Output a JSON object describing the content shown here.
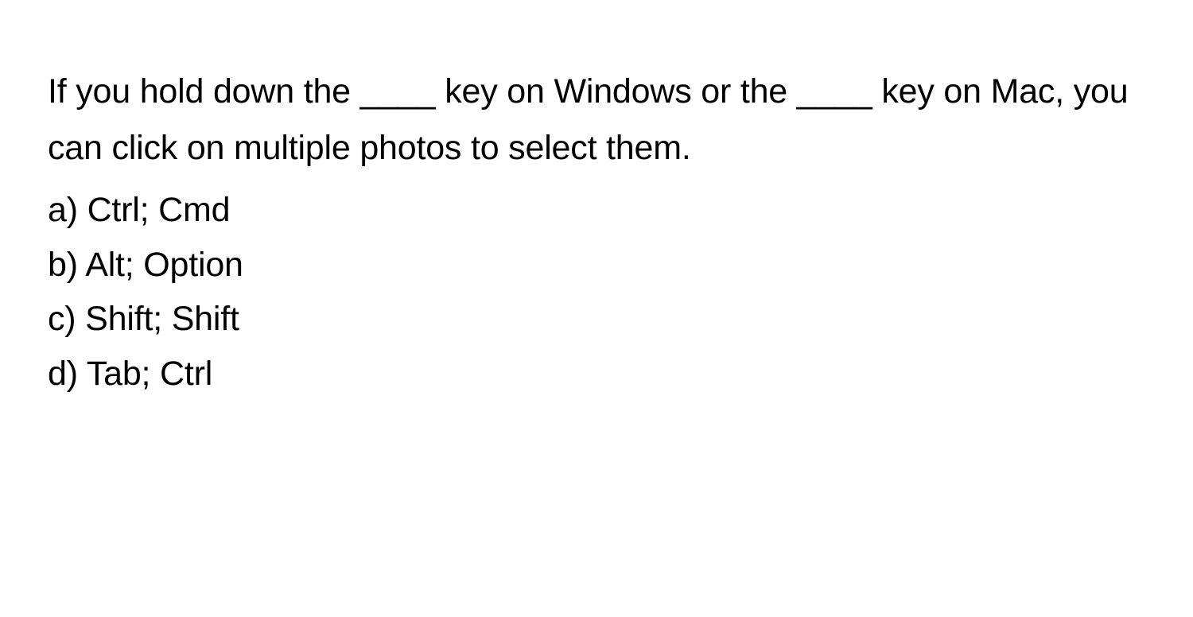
{
  "question": "If you hold down the ____ key on Windows or the ____ key on Mac, you can click on multiple photos to select them.",
  "options": {
    "a": "a) Ctrl; Cmd",
    "b": "b) Alt; Option",
    "c": "c) Shift; Shift",
    "d": "d) Tab; Ctrl"
  }
}
